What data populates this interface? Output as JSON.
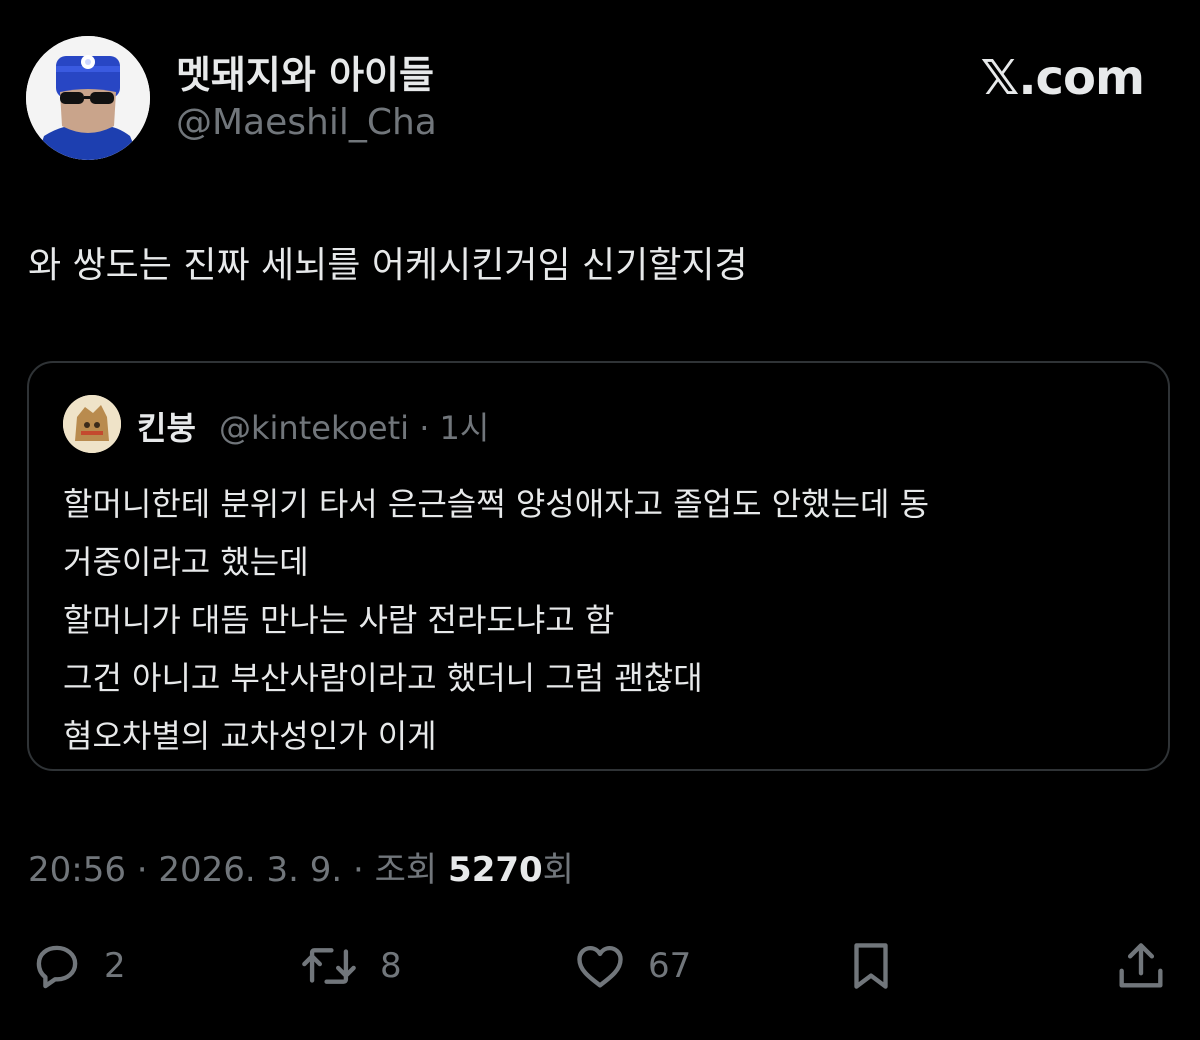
{
  "author": {
    "display_name": "멧돼지와 아이들",
    "handle": "@Maeshil_Cha"
  },
  "brand": "𝕏.com",
  "tweet": {
    "text": "와 쌍도는 진짜 세뇌를 어케시킨거임 신기할지경"
  },
  "quoted": {
    "name": "킨붕",
    "meta": "@kintekoeti · 1시",
    "lines": [
      "할머니한테 분위기 타서 은근슬쩍 양성애자고 졸업도 안했는데 동",
      "거중이라고 했는데",
      "할머니가 대뜸 만나는 사람 전라도냐고 함",
      "그건 아니고 부산사람이라고 했더니 그럼 괜찮대",
      "혐오차별의 교차성인가 이게"
    ]
  },
  "timestamp": {
    "time_date": "20:56 · 2026. 3. 9. · 조회 ",
    "views": "5270",
    "views_suffix": "회"
  },
  "actions": {
    "reply_count": "2",
    "retweet_count": "8",
    "like_count": "67"
  },
  "icons": [
    "reply-icon",
    "retweet-icon",
    "like-icon",
    "bookmark-icon",
    "share-icon"
  ],
  "colors": {
    "background": "#000000",
    "text": "#e7e9ea",
    "secondary": "#71767b",
    "border": "#2f3336"
  }
}
